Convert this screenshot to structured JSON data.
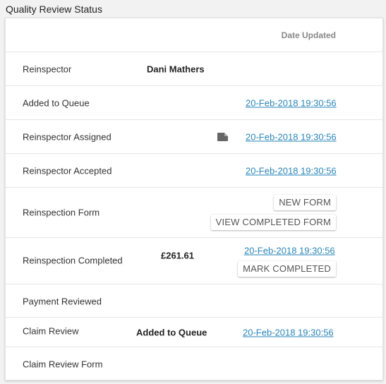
{
  "page": {
    "title": "Quality Review Status"
  },
  "table": {
    "header": {
      "date_col": "Date Updated"
    },
    "rows": {
      "reinspector": {
        "label": "Reinspector",
        "value": "Dani Mathers"
      },
      "added_to_queue": {
        "label": "Added to Queue",
        "date": "20-Feb-2018 19:30:56"
      },
      "reinspector_assigned": {
        "label": "Reinspector Assigned",
        "icon": "document-icon",
        "date": "20-Feb-2018 19:30:56"
      },
      "reinspector_accepted": {
        "label": "Reinspector Accepted",
        "date": "20-Feb-2018 19:30:56"
      },
      "reinspection_form": {
        "label": "Reinspection Form",
        "new_form_button": "NEW FORM",
        "view_completed_button": "VIEW COMPLETED FORM"
      },
      "reinspection_completed": {
        "label": "Reinspection Completed",
        "amount": "£261.61",
        "date": "20-Feb-2018 19:30:56",
        "mark_completed_button": "MARK COMPLETED"
      },
      "payment_reviewed": {
        "label": "Payment Reviewed"
      },
      "claim_review": {
        "label": "Claim Review",
        "status": "Added to Queue",
        "date": "20-Feb-2018 19:30:56"
      },
      "claim_review_form": {
        "label": "Claim Review Form"
      }
    }
  },
  "colors": {
    "link": "#2a86b8",
    "header_text": "#888888",
    "icon": "#666666"
  }
}
